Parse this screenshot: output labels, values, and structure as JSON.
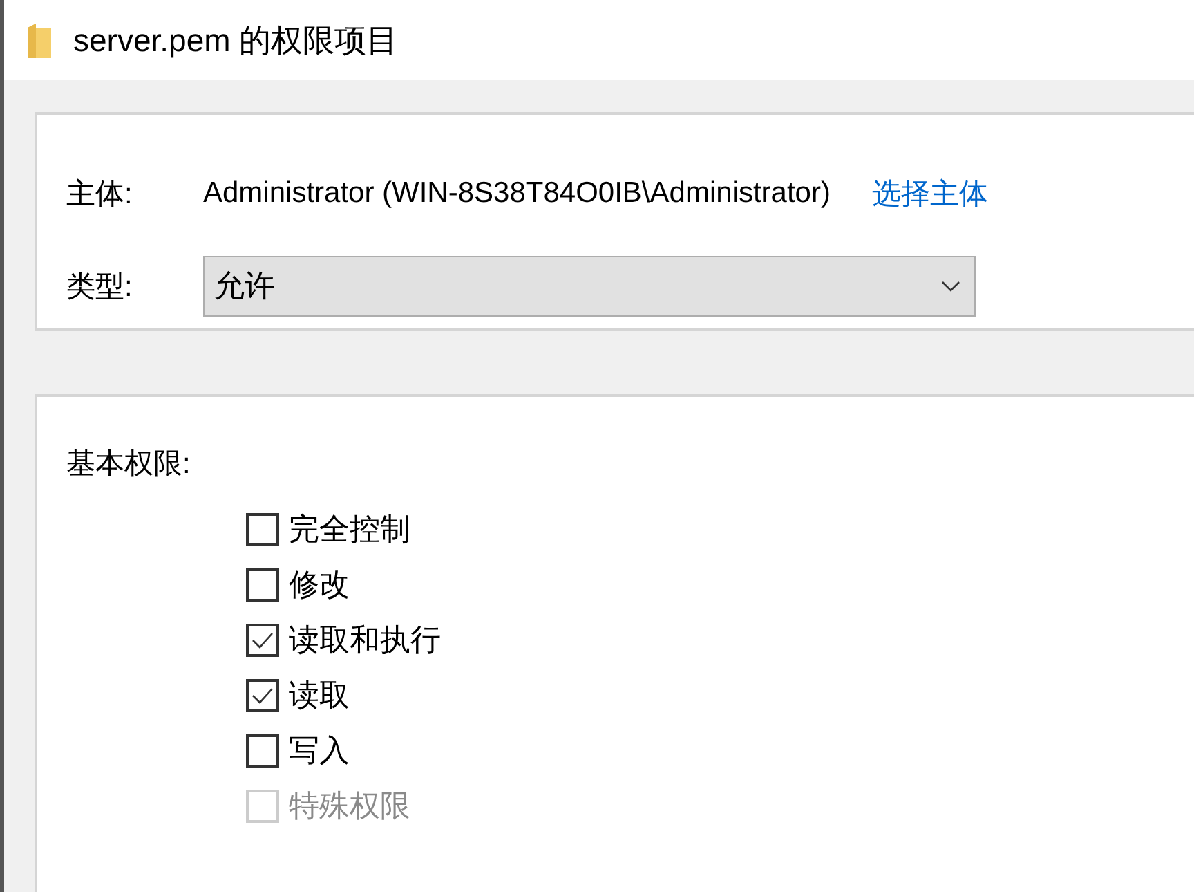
{
  "window": {
    "title": "server.pem 的权限项目"
  },
  "principal": {
    "label": "主体:",
    "value": "Administrator (WIN-8S38T84O0IB\\Administrator)",
    "link": "选择主体"
  },
  "type": {
    "label": "类型:",
    "value": "允许"
  },
  "permissions": {
    "heading": "基本权限:",
    "items": [
      {
        "label": "完全控制",
        "checked": false,
        "disabled": false
      },
      {
        "label": "修改",
        "checked": false,
        "disabled": false
      },
      {
        "label": "读取和执行",
        "checked": true,
        "disabled": false
      },
      {
        "label": "读取",
        "checked": true,
        "disabled": false
      },
      {
        "label": "写入",
        "checked": false,
        "disabled": false
      },
      {
        "label": "特殊权限",
        "checked": false,
        "disabled": true
      }
    ]
  }
}
